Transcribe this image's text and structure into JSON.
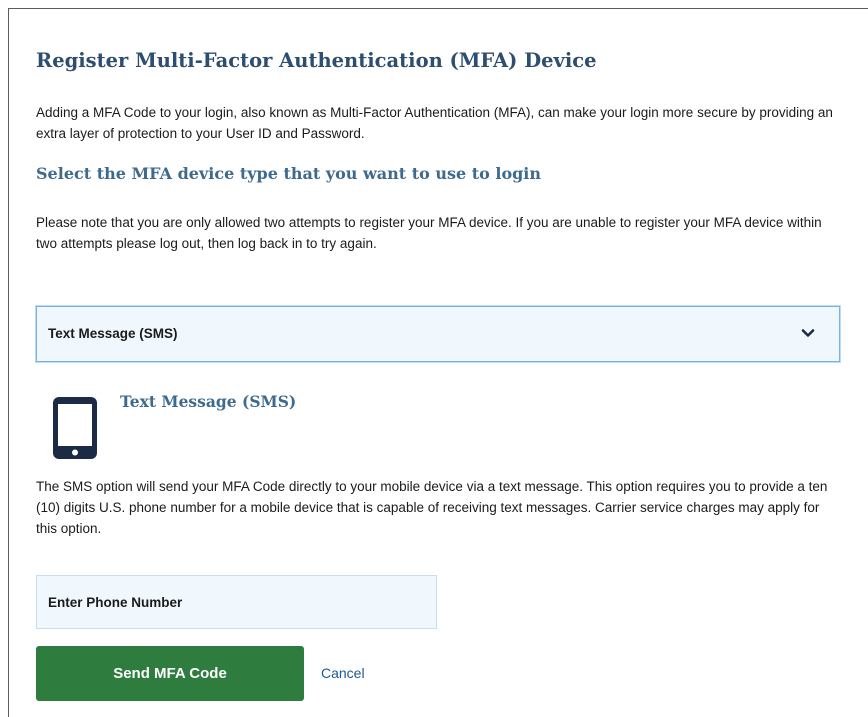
{
  "page": {
    "title": "Register Multi-Factor Authentication (MFA) Device",
    "intro": "Adding a MFA Code to your login, also known as Multi-Factor Authentication (MFA), can make your login more secure by providing an extra layer of protection to your User ID and Password.",
    "subtitle": "Select the MFA device type that you want to use to login",
    "note": "Please note that you are only allowed two attempts to register your MFA device. If you are unable to register your MFA device within two attempts please log out, then log back in to try again."
  },
  "device_select": {
    "selected": "Text Message (SMS)",
    "icon": "chevron-down-icon"
  },
  "device_info": {
    "icon": "mobile-phone-icon",
    "title": "Text Message (SMS)",
    "description": "The SMS option will send your MFA Code directly to your mobile device via a text message. This option requires you to provide a ten (10) digits U.S. phone number for a mobile device that is capable of receiving text messages. Carrier service charges may apply for this option."
  },
  "phone_field": {
    "placeholder": "Enter Phone Number",
    "value": ""
  },
  "actions": {
    "send_label": "Send MFA Code",
    "cancel_label": "Cancel"
  },
  "colors": {
    "heading": "#2d4e6e",
    "subheading": "#3e6a8d",
    "select_border": "#73b3e7",
    "field_background": "#f0f8fd",
    "primary_button": "#2e7d3e",
    "link": "#1a5a96",
    "icon": "#1b2b45"
  }
}
